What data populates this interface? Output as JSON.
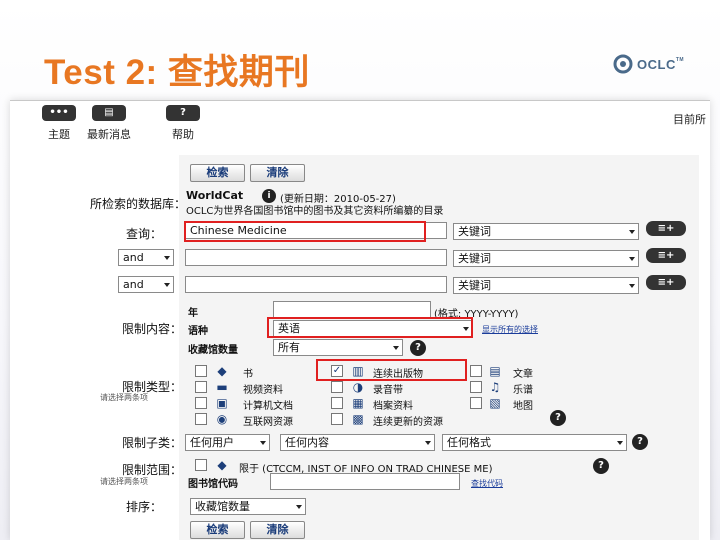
{
  "slide": {
    "title": "Test 2: 查找期刊",
    "logo_text": "OCLC",
    "logo_tm": "TM"
  },
  "toolbar": {
    "items": [
      {
        "label": "主题",
        "icon": "topics-icon",
        "glyph": "•••"
      },
      {
        "label": "最新消息",
        "icon": "news-icon",
        "glyph": "▤"
      },
      {
        "label": "帮助",
        "icon": "help-icon",
        "glyph": "?"
      }
    ],
    "current_library": "目前所"
  },
  "buttons": {
    "search": "检索",
    "clear": "清除"
  },
  "database": {
    "label": "所检索的数据库：",
    "name": "WorldCat",
    "updated": "(更新日期：2010-05-27)",
    "description": "OCLC为世界各国图书馆中的图书及其它资料所编纂的目录"
  },
  "query": {
    "label": "查询：",
    "rows": [
      {
        "operator": "",
        "value": "Chinese Medicine",
        "index": "关键词"
      },
      {
        "operator": "and",
        "value": "",
        "index": "关键词"
      },
      {
        "operator": "and",
        "value": "",
        "index": "关键词"
      }
    ],
    "plus_label": "≡+"
  },
  "limits": {
    "label": "限制内容：",
    "year_label": "年",
    "year_value": "",
    "year_format": "(格式: YYYY-YYYY)",
    "language_label": "语种",
    "language_value": "英语",
    "language_link": "显示所有的选择",
    "holdings_label": "收藏馆数量",
    "holdings_value": "所有"
  },
  "types": {
    "label": "限制类型：",
    "sublabel": "请选择两条项",
    "items": [
      {
        "label": "书",
        "checked": false,
        "icon": "book-icon",
        "glyph": "◆"
      },
      {
        "label": "连续出版物",
        "checked": true,
        "icon": "serial-icon",
        "glyph": "▥"
      },
      {
        "label": "文章",
        "checked": false,
        "icon": "article-icon",
        "glyph": "▤"
      },
      {
        "label": "视频资料",
        "checked": false,
        "icon": "video-icon",
        "glyph": "▬"
      },
      {
        "label": "录音带",
        "checked": false,
        "icon": "audio-icon",
        "glyph": "◑"
      },
      {
        "label": "乐谱",
        "checked": false,
        "icon": "score-icon",
        "glyph": "♫"
      },
      {
        "label": "计算机文档",
        "checked": false,
        "icon": "computer-icon",
        "glyph": "▣"
      },
      {
        "label": "档案资料",
        "checked": false,
        "icon": "archive-icon",
        "glyph": "▦"
      },
      {
        "label": "地图",
        "checked": false,
        "icon": "map-icon",
        "glyph": "▧"
      },
      {
        "label": "互联网资源",
        "checked": false,
        "icon": "internet-icon",
        "glyph": "◉"
      },
      {
        "label": "连续更新的资源",
        "checked": false,
        "icon": "updating-icon",
        "glyph": "▩"
      }
    ]
  },
  "subtype": {
    "label": "限制子类：",
    "audience": "任何用户",
    "content": "任何内容",
    "format": "任何格式"
  },
  "scope": {
    "label": "限制范围：",
    "sublabel": "请选择两条项",
    "library_text": "限于 (CTCCM, INST OF INFO ON TRAD CHINESE ME)",
    "code_label": "图书馆代码",
    "code_value": "",
    "code_link": "查找代码"
  },
  "sort": {
    "label": "排序：",
    "value": "收藏馆数量"
  }
}
